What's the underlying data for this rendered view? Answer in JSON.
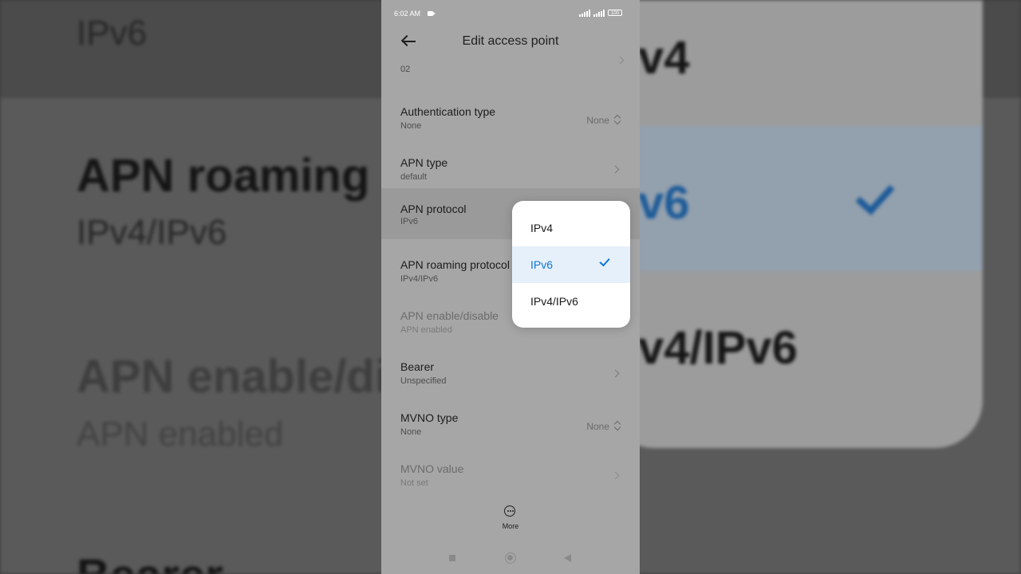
{
  "background": {
    "top_value": "IPv6",
    "selected_fragment": "v6",
    "right_top": "v4",
    "right_bottom": "v4/IPv6",
    "roaming_title": "APN roaming p",
    "roaming_value": "IPv4/IPv6",
    "enable_title": "APN enable/di",
    "enable_value": "APN enabled",
    "bearer_title": "Bearer"
  },
  "status_bar": {
    "time": "6:02 AM",
    "battery": "100"
  },
  "header": {
    "title": "Edit access point"
  },
  "settings": {
    "prev_value": "02",
    "rows": [
      {
        "title": "Authentication type",
        "subtitle": "None",
        "value": "None",
        "control": "updown"
      },
      {
        "title": "APN type",
        "subtitle": "default",
        "control": "chevron"
      },
      {
        "title": "APN protocol",
        "subtitle": "IPv6",
        "control": "dropdown"
      },
      {
        "title": "APN roaming protocol",
        "subtitle": "IPv4/IPv6",
        "control": "dropdown"
      },
      {
        "title": "APN enable/disable",
        "subtitle": "APN enabled",
        "control": "toggle",
        "disabled": true
      },
      {
        "title": "Bearer",
        "subtitle": "Unspecified",
        "control": "chevron"
      },
      {
        "title": "MVNO type",
        "subtitle": "None",
        "value": "None",
        "control": "updown"
      },
      {
        "title": "MVNO value",
        "subtitle": "Not set",
        "control": "chevron",
        "disabled": true
      }
    ]
  },
  "dropdown": {
    "options": [
      {
        "label": "IPv4",
        "selected": false
      },
      {
        "label": "IPv6",
        "selected": true
      },
      {
        "label": "IPv4/IPv6",
        "selected": false
      }
    ]
  },
  "bottom": {
    "more_label": "More"
  },
  "colors": {
    "accent": "#0f74d9",
    "selected_bg": "#e6f0fb",
    "phone_bg": "#a6a6a6"
  }
}
